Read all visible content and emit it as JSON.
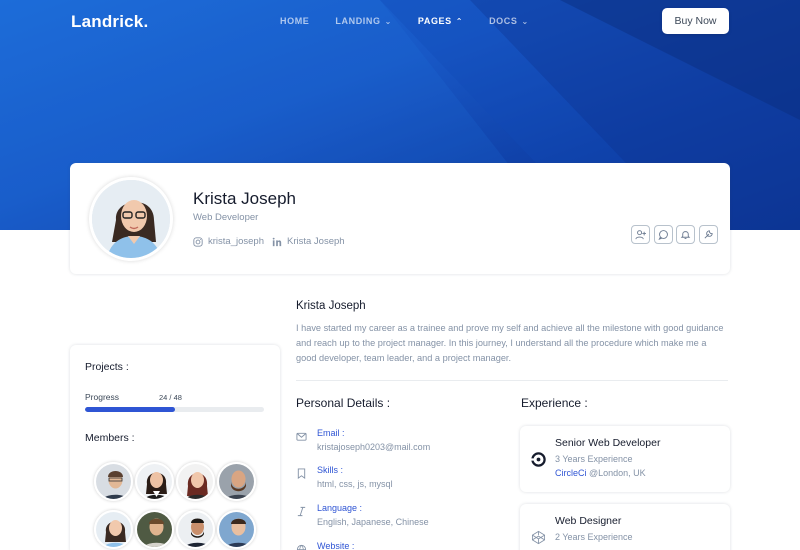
{
  "app": {
    "brand": "Landrick.",
    "buy_label": "Buy Now"
  },
  "nav": {
    "items": [
      {
        "label": "HOME",
        "has_dropdown": false,
        "active": false,
        "chevron": ""
      },
      {
        "label": "LANDING",
        "has_dropdown": true,
        "active": false,
        "chevron": "⌄"
      },
      {
        "label": "PAGES",
        "has_dropdown": true,
        "active": true,
        "chevron": "⌃"
      },
      {
        "label": "DOCS",
        "has_dropdown": true,
        "active": false,
        "chevron": "⌄"
      }
    ]
  },
  "profile": {
    "name": "Krista Joseph",
    "role": "Web Developer",
    "instagram": "krista_joseph",
    "linkedin": "Krista Joseph",
    "actions": [
      "user-plus-icon",
      "message-icon",
      "bell-icon",
      "tool-icon"
    ]
  },
  "sidebar": {
    "projects_title": "Projects :",
    "progress_label": "Progress",
    "progress_text": "24 / 48",
    "progress_value": 0.5,
    "members_title": "Members :"
  },
  "about": {
    "name": "Krista Joseph",
    "bio": "I have started my career as a trainee and prove my self and achieve all the milestone with good guidance and reach up to the project manager. In this journey, I understand all the procedure which make me a good developer, team leader, and a project manager."
  },
  "personal": {
    "title": "Personal Details :",
    "email_label": "Email :",
    "email_value": "kristajoseph0203@mail.com",
    "skills_label": "Skills :",
    "skills": [
      "html",
      "css",
      "js",
      "mysql"
    ],
    "language_label": "Language :",
    "languages": [
      "English",
      "Japanese",
      "Chinese"
    ],
    "website_label": "Website :"
  },
  "experience": {
    "title": "Experience :",
    "items": [
      {
        "title": "Senior Web Developer",
        "years": "3 Years Experience",
        "company": "CircleCi",
        "location": "@London, UK"
      },
      {
        "title": "Web Designer",
        "years": "2 Years Experience",
        "company": "",
        "location": ""
      }
    ]
  },
  "colors": {
    "primary": "#2f55d4",
    "hero_start": "#1c6bd8",
    "hero_end": "#0b2f8a",
    "heading": "#161c2d",
    "muted": "#8492a6"
  }
}
